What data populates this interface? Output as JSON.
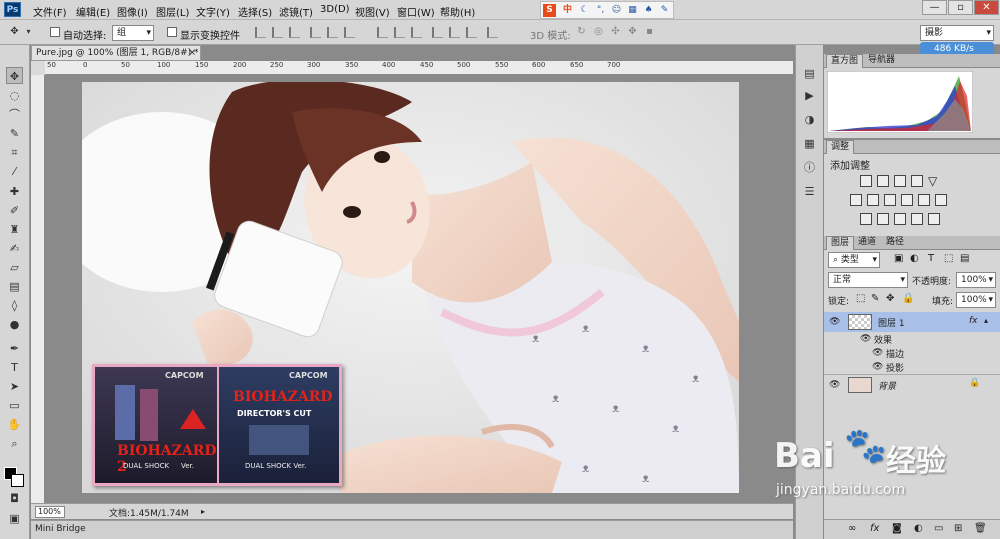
{
  "app": {
    "logo": "Ps"
  },
  "menu": [
    "文件(F)",
    "编辑(E)",
    "图像(I)",
    "图层(L)",
    "文字(Y)",
    "选择(S)",
    "滤镜(T)",
    "3D(D)",
    "视图(V)",
    "窗口(W)",
    "帮助(H)"
  ],
  "ime": {
    "brand": "S",
    "lang": "中"
  },
  "window_controls": {
    "minimize": "—",
    "restore": "▫",
    "close": "✕"
  },
  "options": {
    "auto_select_label": "自动选择:",
    "auto_select_value": "组",
    "show_transform_label": "显示变换控件",
    "mode_3d_label": "3D 模式:",
    "workspace": "摄影"
  },
  "speed": "486 KB/s",
  "document": {
    "tab_title": "Pure.jpg @ 100% (图层 1, RGB/8#) *",
    "tab_close": "×",
    "ruler_ticks": [
      "50",
      "0",
      "50",
      "100",
      "150",
      "200",
      "250",
      "300",
      "350",
      "400",
      "450",
      "500",
      "550",
      "600",
      "650",
      "700"
    ],
    "zoom": "100%",
    "doc_info": "文档:1.45M/1.74M"
  },
  "image": {
    "game_brand": "CAPCOM",
    "cover1_title": "BIOHAZARD 2",
    "cover1_sub": "DUAL SHOCK",
    "cover1_ver": "Ver.",
    "cover2_title": "BIOHAZARD",
    "cover2_sub": "DIRECTOR'S CUT",
    "cover2_ver": "DUAL SHOCK Ver."
  },
  "mini_bridge": "Mini Bridge",
  "panels": {
    "histogram_tab": "直方图",
    "navigator_tab": "导航器",
    "adjust_tab": "调整",
    "adjust_title": "添加调整",
    "layers_tab": "图层",
    "channels_tab": "通道",
    "paths_tab": "路径",
    "filter_kind": "类型",
    "blend_mode": "正常",
    "opacity_label": "不透明度:",
    "opacity_value": "100%",
    "lock_label": "锁定:",
    "fill_label": "填充:",
    "fill_value": "100%"
  },
  "layers": [
    {
      "name": "图层 1",
      "fx": "fx"
    },
    {
      "name": "效果"
    },
    {
      "name": "描边"
    },
    {
      "name": "投影"
    },
    {
      "name": "背景"
    }
  ],
  "watermark": {
    "brand": "Bai",
    "brand2": "经验",
    "url": "jingyan.baidu.com"
  },
  "colors": {
    "accent": "#4a90d9",
    "ps_blue": "#0b3a6e",
    "selected_layer": "#a8c0e8"
  }
}
